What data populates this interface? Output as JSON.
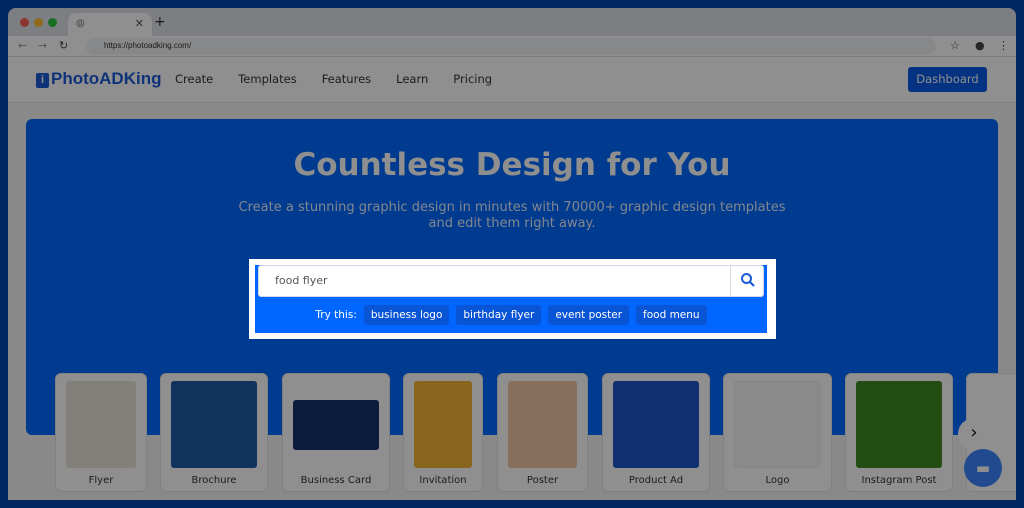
{
  "browser": {
    "url": "https://photoadking.com/"
  },
  "nav": {
    "logo": "PhotoADKing",
    "items": [
      "Create",
      "Templates",
      "Features",
      "Learn",
      "Pricing"
    ],
    "dashboard": "Dashboard"
  },
  "hero": {
    "title": "Countless Design for You",
    "subtitle": "Create a stunning graphic design in minutes with 70000+ graphic design templates and edit them right away."
  },
  "search": {
    "value": "food flyer",
    "try_label": "Try this:",
    "suggestions": [
      "business logo",
      "birthday flyer",
      "event poster",
      "food menu"
    ]
  },
  "categories": [
    {
      "label": "Flyer",
      "color": "#e9e4dc"
    },
    {
      "label": "Brochure",
      "color": "#1f5aa6"
    },
    {
      "label": "Business Card",
      "color": "#13306b"
    },
    {
      "label": "Invitation",
      "color": "#f2b233"
    },
    {
      "label": "Poster",
      "color": "#f3c6a5"
    },
    {
      "label": "Product Ad",
      "color": "#1d55c9"
    },
    {
      "label": "Logo",
      "color": "#f6f6f6"
    },
    {
      "label": "Instagram Post",
      "color": "#3f8a23"
    }
  ],
  "colors": {
    "accent": "#0069ff",
    "frame": "#0047ab"
  }
}
